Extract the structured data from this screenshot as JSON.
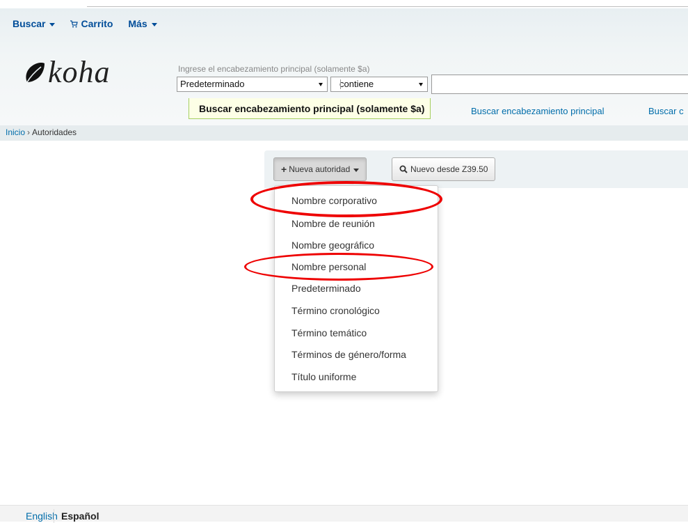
{
  "topnav": {
    "search": "Buscar",
    "cart": "Carrito",
    "more": "Más"
  },
  "logo": {
    "text": "koha"
  },
  "search": {
    "hint": "Ingrese el encabezamiento principal (solamente $a)",
    "type_value": "Predeterminado",
    "operator_value": "contiene",
    "query_value": ""
  },
  "tabs": {
    "active": "Buscar encabezamiento principal (solamente $a)",
    "second": "Buscar encabezamiento principal",
    "third": "Buscar c"
  },
  "breadcrumb": {
    "home": "Inicio",
    "separator": "›",
    "current": "Autoridades"
  },
  "toolbar": {
    "new_authority": "Nueva autoridad",
    "new_from_z3950": "Nuevo desde Z39.50"
  },
  "menu": {
    "items": [
      "Nombre corporativo",
      "Nombre de reunión",
      "Nombre geográfico",
      "Nombre personal",
      "Predeterminado",
      "Término cronológico",
      "Término temático",
      "Términos de género/forma",
      "Título uniforme"
    ]
  },
  "footer": {
    "lang_en": "English",
    "lang_es": "Español"
  },
  "colors": {
    "link": "#006daa",
    "nav": "#004d99",
    "highlight_circle": "#e00000",
    "active_tab_border": "#a6cf60"
  }
}
